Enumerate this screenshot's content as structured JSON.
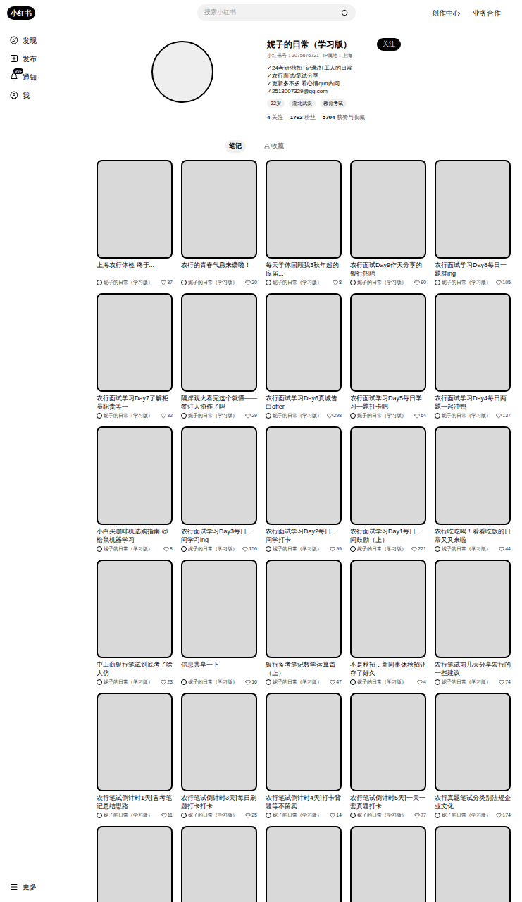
{
  "header": {
    "logo": "小红书",
    "search_placeholder": "搜索小红书",
    "links": [
      "创作中心",
      "业务合作"
    ]
  },
  "sidebar": {
    "items": [
      {
        "label": "发现",
        "icon": "compass",
        "badge": "",
        "selected": false
      },
      {
        "label": "发布",
        "icon": "plus",
        "badge": "",
        "selected": false
      },
      {
        "label": "通知",
        "icon": "bell",
        "badge": "99+",
        "selected": false
      },
      {
        "label": "我",
        "icon": "user",
        "badge": "",
        "selected": false
      }
    ],
    "more": "更多"
  },
  "profile": {
    "name": "妮子的日常（学习版）",
    "follow_button": "关注",
    "meta": "小红书号：2075676721   IP属地：上海",
    "bio": [
      "✓24考研/秋招+记录/打工人的日常",
      "✓农行面试/笔试分享",
      "✓更新多不多 看心情qun内问",
      "✓2513007329@qq.com"
    ],
    "tags": [
      "22岁",
      "湖北武汉",
      "教育考试"
    ],
    "stats": [
      {
        "value": "4",
        "label": "关注"
      },
      {
        "value": "1762",
        "label": "粉丝"
      },
      {
        "value": "5704",
        "label": "获赞与收藏"
      }
    ]
  },
  "tabs": [
    {
      "label": "笔记",
      "selected": true,
      "locked": false
    },
    {
      "label": "收藏",
      "selected": false,
      "locked": true
    }
  ],
  "notes": [
    {
      "title": "上海农行体检 终于...",
      "author": "妮子的日常（学习版）",
      "likes": "37"
    },
    {
      "title": "农行的青春气息来袭啦！",
      "author": "妮子的日常（学习版）",
      "likes": "20"
    },
    {
      "title": "每天学体回顾我3秋年超的应届...",
      "author": "妮子的日常（学习版）",
      "likes": "8"
    },
    {
      "title": "农行面试Day9作天分享的银行招聘",
      "author": "妮子的日常（学习版）",
      "likes": "90"
    },
    {
      "title": "农行面试学习Day8每日一题群ing",
      "author": "妮子的日常（学习版）",
      "likes": "105"
    },
    {
      "title": "农行面试学习Day7了解柜员职责等一",
      "author": "妮子的日常（学习版）",
      "likes": "32"
    },
    {
      "title": "隔岸观火看完这个就懂——签订人协作了吗",
      "author": "妮子的日常（学习版）",
      "likes": "29"
    },
    {
      "title": "农行面试学习Day6真诚告白offer",
      "author": "妮子的日常（学习版）",
      "likes": "298"
    },
    {
      "title": "农行面试学习Day5每日学习一题打卡吧",
      "author": "妮子的日常（学习版）",
      "likes": "64"
    },
    {
      "title": "农行面试学习Day4每日两题一起冲鸭",
      "author": "妮子的日常（学习版）",
      "likes": "137"
    },
    {
      "title": "小白买咖啡机选购指南 @松鼠机器学习",
      "author": "妮子的日常（学习版）",
      "likes": "8"
    },
    {
      "title": "农行面试学习Day3每日一问学习ing",
      "author": "妮子的日常（学习版）",
      "likes": "156"
    },
    {
      "title": "农行面试学习Day2每日一问学打卡",
      "author": "妮子的日常（学习版）",
      "likes": "99"
    },
    {
      "title": "农行面试学习Day1每日一问鼓励（上）",
      "author": "妮子的日常（学习版）",
      "likes": "221"
    },
    {
      "title": "农行吃吃喝！看看吃饭的日常又又来啦",
      "author": "妮子的日常（学习版）",
      "likes": "44"
    },
    {
      "title": "中工商银行笔试到底考了啥人仿",
      "author": "妮子的日常（学习版）",
      "likes": "23"
    },
    {
      "title": "信息共享一下",
      "author": "妮子的日常（学习版）",
      "likes": "16"
    },
    {
      "title": "银行备考笔记数学运算篇（上）",
      "author": "妮子的日常（学习版）",
      "likes": "47"
    },
    {
      "title": "不是秋招，新同事休秋招还存了好久",
      "author": "妮子的日常（学习版）",
      "likes": "4"
    },
    {
      "title": "农行笔试前几天分享农行的一些建议",
      "author": "妮子的日常（学习版）",
      "likes": "74"
    },
    {
      "title": "农行笔试倒计时1天]备考笔记总结思路",
      "author": "妮子的日常（学习版）",
      "likes": "11"
    },
    {
      "title": "农行笔试倒计时3天]每日刷题打卡打卡",
      "author": "妮子的日常（学习版）",
      "likes": "25"
    },
    {
      "title": "农行笔试倒计时4天]打卡背题等不留卖",
      "author": "妮子的日常（学习版）",
      "likes": "14"
    },
    {
      "title": "农行笔试倒计时5天]一天一套真题打卡",
      "author": "妮子的日常（学习版）",
      "likes": "77"
    },
    {
      "title": "农行真题笔试分类别法规企业文化",
      "author": "妮子的日常（学习版）",
      "likes": "174"
    }
  ]
}
